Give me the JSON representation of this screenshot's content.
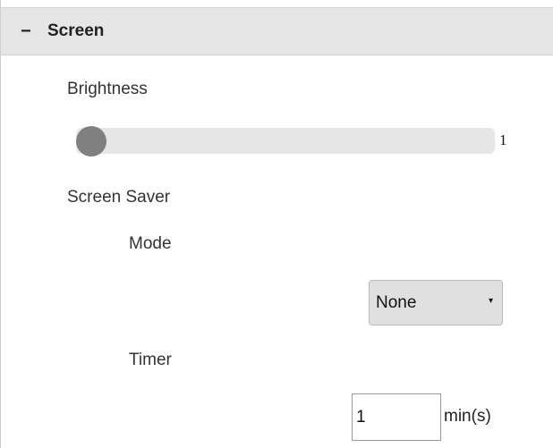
{
  "section": {
    "collapse_symbol": "−",
    "title": "Screen"
  },
  "brightness": {
    "label": "Brightness",
    "value": "1",
    "slider_fraction": 0.0
  },
  "screen_saver": {
    "label": "Screen Saver",
    "mode": {
      "label": "Mode",
      "selected": "None",
      "caret": "▾"
    },
    "timer": {
      "label": "Timer",
      "value": "1",
      "unit": "min(s)"
    }
  },
  "colors": {
    "header_bg": "#e6e6e6",
    "slider_track": "#e6e6e6",
    "slider_thumb": "#808080",
    "select_bg": "#e0e0e0"
  }
}
